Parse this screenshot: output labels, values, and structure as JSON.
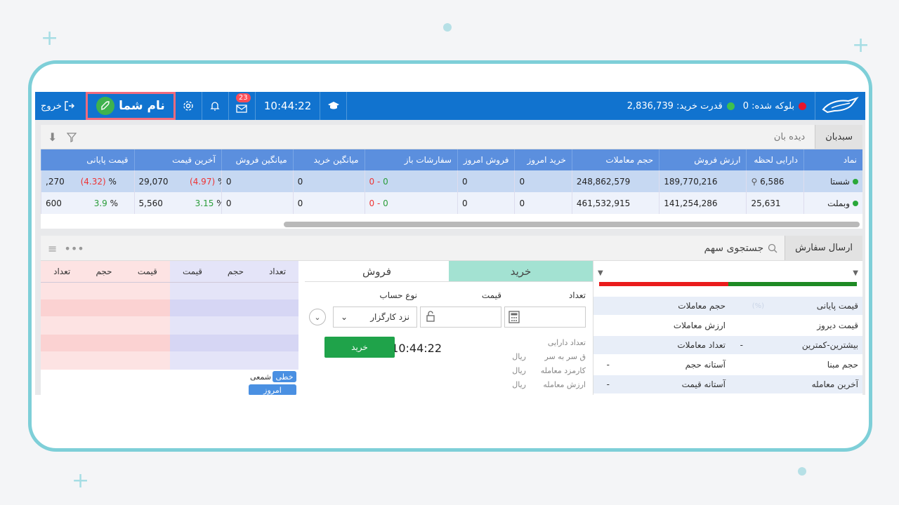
{
  "topbar": {
    "blocked_label": "بلوکه شده: 0",
    "buying_power_label": "قدرت خرید: 2,836,739",
    "time": "10:44:22",
    "notification_count": "23",
    "user_name": "نام شما",
    "exit_label": "خروج"
  },
  "watchlist": {
    "tabs": [
      "سبدبان",
      "دیده بان"
    ],
    "columns": [
      "نماد",
      "دارایی لحظه",
      "ارزش فروش",
      "حجم معاملات",
      "خرید امروز",
      "فروش امروز",
      "سفارشات باز",
      "میانگین خرید",
      "میانگین فروش",
      "آخرین قیمت",
      "قیمت پایانی"
    ],
    "rows": [
      {
        "symbol": "شستا",
        "asset": "6,586",
        "sell_value": "189,770,216",
        "volume": "248,862,579",
        "buy_today": "0",
        "sell_today": "0",
        "open_sell": "0",
        "open_buy": "0",
        "avg_buy": "0",
        "avg_sell": "0",
        "last_pct": "(4.97)",
        "last_price": "29,070",
        "close_pct": "(4.32)",
        "close_price": ",270"
      },
      {
        "symbol": "وبملت",
        "asset": "25,631",
        "sell_value": "141,254,286",
        "volume": "461,532,915",
        "buy_today": "0",
        "sell_today": "0",
        "open_sell": "0",
        "open_buy": "0",
        "avg_buy": "0",
        "avg_sell": "0",
        "last_pct": "3.15",
        "last_price": "5,560",
        "close_pct": "3.9",
        "close_price": "600"
      }
    ],
    "pct_sign": "%",
    "dash": "-"
  },
  "order_panel": {
    "tab": "ارسال سفارش",
    "search_placeholder": "جستجوی سهم",
    "buy_tab": "خرید",
    "sell_tab": "فروش",
    "qty_label": "تعداد",
    "price_label": "قیمت",
    "account_type_label": "نوع حساب",
    "account_type_value": "نزد کارگزار",
    "buy_button": "خرید",
    "time": "10:44:22",
    "asset_count_label": "تعداد دارایی",
    "breakeven_label": "ق سر به سر",
    "fee_label": "کارمزد معامله",
    "trade_value_label": "ارزش معامله",
    "rial": "ریال"
  },
  "info_panel": {
    "rows": [
      {
        "a": "قیمت پایانی",
        "b": "حجم معاملات",
        "v1": "",
        "v2": ""
      },
      {
        "a": "قیمت دیروز",
        "b": "ارزش معاملات",
        "v1": "",
        "v2": ""
      },
      {
        "a": "بیشترین-کمترین",
        "b": "تعداد معاملات",
        "v1": "-",
        "v2": ""
      },
      {
        "a": "حجم مبنا",
        "b": "آستانه حجم",
        "v1": "",
        "v2": "-"
      },
      {
        "a": "آخرین معامله",
        "b": "آستانه قیمت",
        "v1": "",
        "v2": "-"
      }
    ]
  },
  "order_book": {
    "buy_headers": [
      "تعداد",
      "حجم",
      "قیمت"
    ],
    "sell_headers": [
      "قیمت",
      "حجم",
      "تعداد"
    ],
    "chart_chips": [
      "خطی",
      "شمعی",
      "امروز"
    ]
  },
  "colors": {
    "topbar": "#1173cf",
    "header": "#5b8fde",
    "buy_tab": "#a3e2d2",
    "buy_button": "#1fa34a",
    "highlight_border": "#f06b7d"
  }
}
